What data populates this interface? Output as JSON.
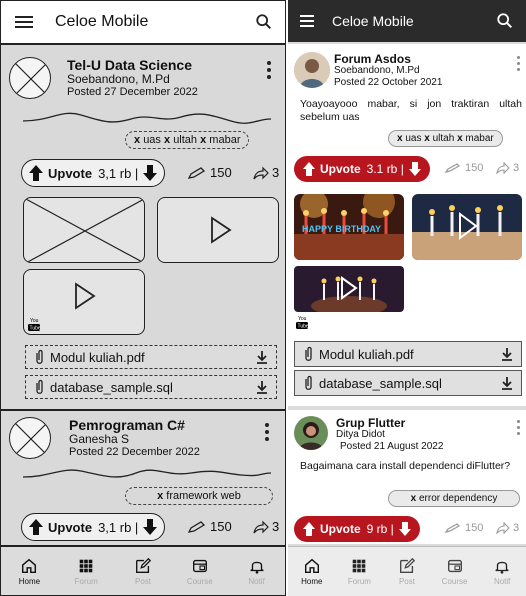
{
  "app": {
    "title": "Celoe Mobile"
  },
  "left": {
    "posts": [
      {
        "title": "Tel-U Data Science",
        "author": "Soebandono, M.Pd",
        "date": "Posted 27 December 2022",
        "tags": [
          "uas",
          "ultah",
          "mabar"
        ],
        "upvote_label": "Upvote",
        "upvote_count": "3,1 rb |",
        "views": "150",
        "shares": "3",
        "files": [
          "Modul kuliah.pdf",
          "database_sample.sql"
        ]
      },
      {
        "title": "Pemrograman C#",
        "author": "Ganesha S",
        "date": "Posted 22 December 2022",
        "tags": [
          "framework web"
        ],
        "upvote_label": "Upvote",
        "upvote_count": "3,1 rb |",
        "views": "150",
        "shares": "3"
      }
    ]
  },
  "right": {
    "posts": [
      {
        "title": "Forum Asdos",
        "author": "Soebandono, M.Pd",
        "date": "Posted 22 October 2021",
        "body": "Yoayoayooo mabar, si jon traktiran ultah sebelum uas",
        "tags": [
          "uas",
          "ultah",
          "mabar"
        ],
        "upvote_label": "Upvote",
        "upvote_count": "3.1 rb |",
        "views": "150",
        "shares": "3",
        "files": [
          "Modul kuliah.pdf",
          "database_sample.sql"
        ]
      },
      {
        "title": "Grup Flutter",
        "author": "Ditya Didot",
        "date": "Posted 21 August 2022",
        "body": "Bagaimana cara install dependenci diFlutter?",
        "tags": [
          "error dependency"
        ],
        "upvote_label": "Upvote",
        "upvote_count": "9 rb |",
        "views": "150",
        "shares": "3"
      }
    ]
  },
  "nav": [
    "Home",
    "Forum",
    "Post",
    "Course",
    "Notif"
  ],
  "youtube_logo": "You Tube",
  "photo_overlay_text": "HAPPY BIRTHDAY",
  "colors": {
    "accent": "#b8161f",
    "appbar_dark": "#2b2b2b"
  }
}
